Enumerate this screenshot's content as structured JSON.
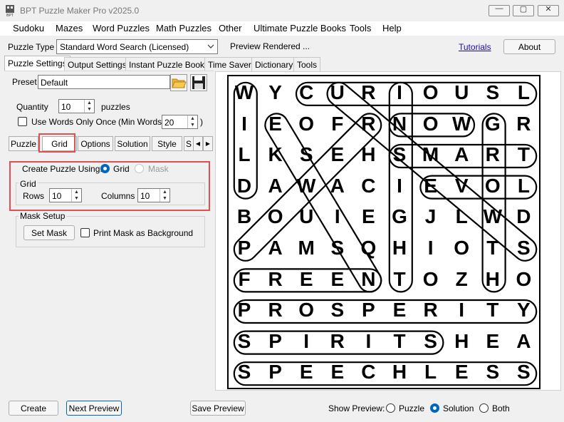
{
  "window": {
    "title": "BPT Puzzle Maker Pro v2025.0",
    "minimize": "—",
    "maximize": "▢",
    "close": "✕"
  },
  "menu": [
    "Sudoku",
    "Mazes",
    "Word Puzzles",
    "Math Puzzles",
    "Other",
    "Ultimate Puzzle Books",
    "Tools",
    "Help"
  ],
  "toolbar": {
    "puzzle_type_label": "Puzzle Type",
    "puzzle_type_value": "Standard Word Search (Licensed)",
    "status": "Preview Rendered ...",
    "tutorials": "Tutorials",
    "about": "About"
  },
  "tabs": [
    "Puzzle Settings",
    "Output Settings",
    "Instant Puzzle Books",
    "Time Saver",
    "Dictionary",
    "Tools"
  ],
  "settings": {
    "preset_label": "Preset",
    "preset_value": "Default",
    "quantity_label": "Quantity",
    "quantity_value": "10",
    "quantity_unit": "puzzles",
    "use_words_once": "Use Words Only Once",
    "min_words_label": "(Min Words:",
    "min_words_value": "20",
    "min_words_close": ")",
    "subtabs": [
      "Puzzle",
      "Grid",
      "Options",
      "Solution",
      "Style",
      "S"
    ],
    "create_using_label": "Create Puzzle Using:",
    "opt_grid": "Grid",
    "opt_mask": "Mask",
    "grid_group": "Grid",
    "rows_label": "Rows",
    "rows_value": "10",
    "columns_label": "Columns",
    "columns_value": "10",
    "mask_group": "Mask Setup",
    "set_mask": "Set Mask",
    "print_mask": "Print Mask as Background"
  },
  "grid_letters": [
    [
      "W",
      "Y",
      "C",
      "U",
      "R",
      "I",
      "O",
      "U",
      "S",
      "L"
    ],
    [
      "I",
      "E",
      "O",
      "F",
      "R",
      "N",
      "O",
      "W",
      "G",
      "R"
    ],
    [
      "L",
      "K",
      "S",
      "E",
      "H",
      "S",
      "M",
      "A",
      "R",
      "T"
    ],
    [
      "D",
      "A",
      "W",
      "A",
      "C",
      "I",
      "E",
      "V",
      "O",
      "L"
    ],
    [
      "B",
      "O",
      "U",
      "I",
      "E",
      "G",
      "J",
      "L",
      "W",
      "D"
    ],
    [
      "P",
      "A",
      "M",
      "S",
      "Q",
      "H",
      "I",
      "O",
      "T",
      "S"
    ],
    [
      "F",
      "R",
      "E",
      "E",
      "N",
      "T",
      "O",
      "Z",
      "H",
      "O"
    ],
    [
      "P",
      "R",
      "O",
      "S",
      "P",
      "E",
      "R",
      "I",
      "T",
      "Y"
    ],
    [
      "S",
      "P",
      "I",
      "R",
      "I",
      "T",
      "S",
      "H",
      "E",
      "A"
    ],
    [
      "S",
      "P",
      "E",
      "E",
      "C",
      "H",
      "L",
      "E",
      "S",
      "S"
    ]
  ],
  "bottom": {
    "create": "Create",
    "next_preview": "Next Preview",
    "save_preview": "Save Preview",
    "show_preview_label": "Show Preview:",
    "opt_puzzle": "Puzzle",
    "opt_solution": "Solution",
    "opt_both": "Both"
  }
}
